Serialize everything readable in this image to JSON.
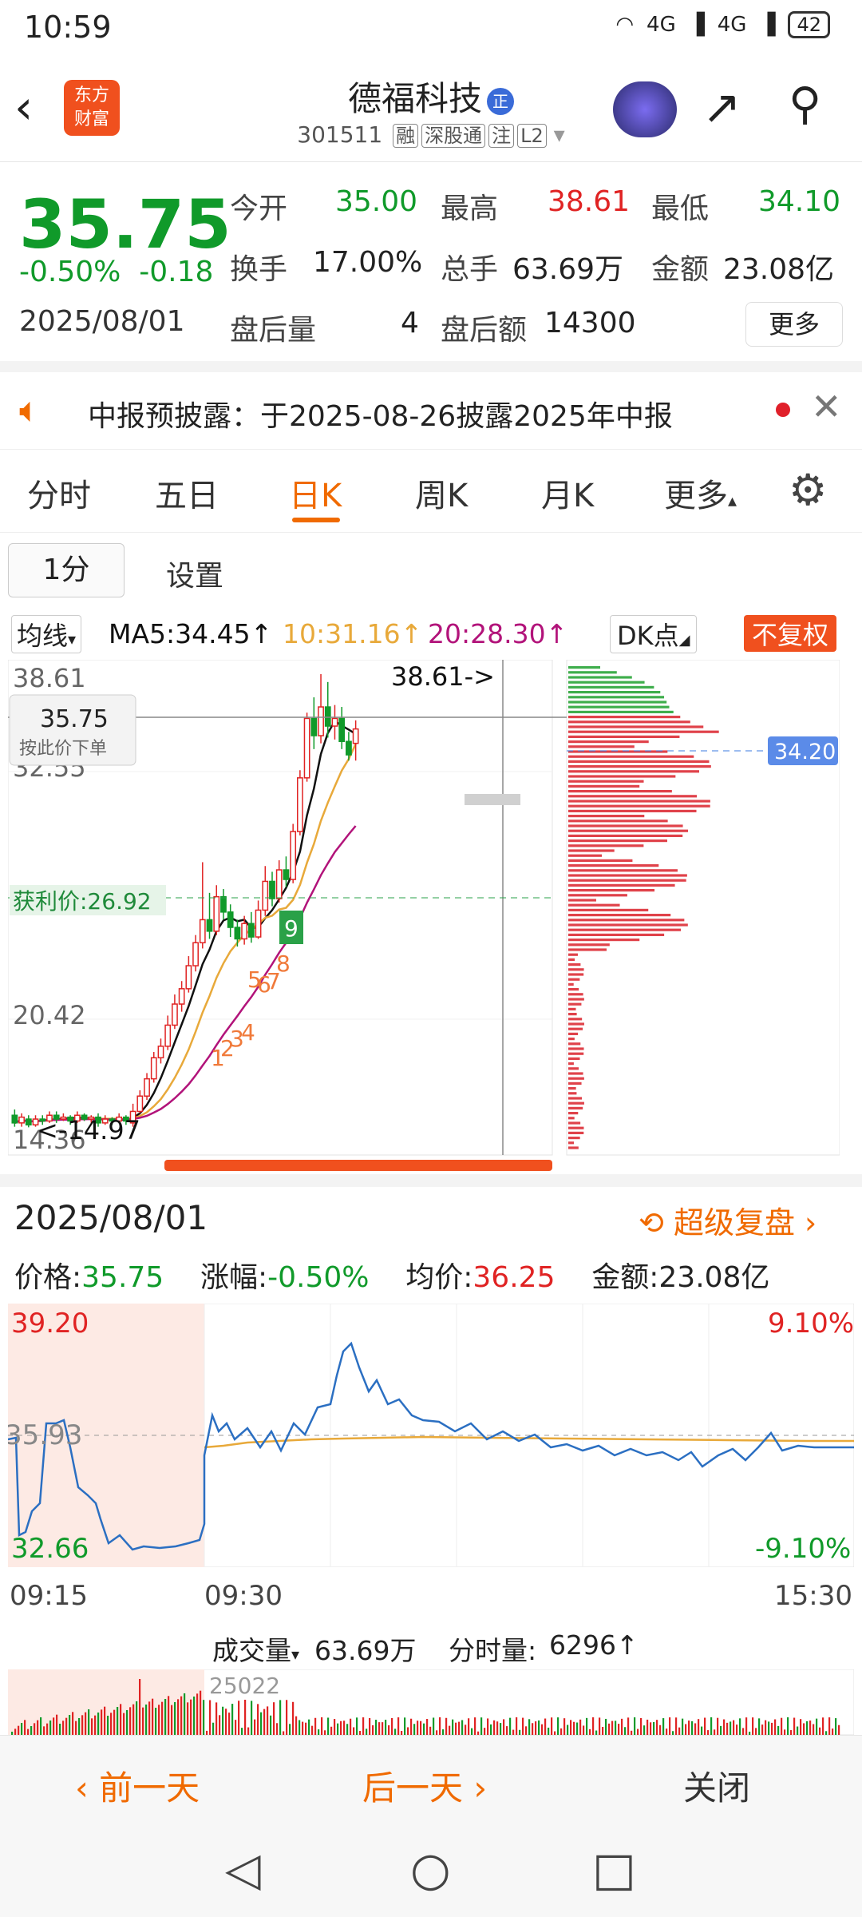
{
  "status": {
    "time": "10:59",
    "signal1": "4G",
    "signal2": "4G",
    "battery": "42"
  },
  "header": {
    "logo_line1": "东方",
    "logo_line2": "财富",
    "stock_name": "德福科技",
    "badge": "正",
    "stock_code": "301511",
    "tags": [
      "融",
      "深股通",
      "注",
      "L2"
    ]
  },
  "quote": {
    "price": "35.75",
    "change_pct": "-0.50%",
    "change": "-0.18",
    "date": "2025/08/01",
    "open_label": "今开",
    "open": "35.00",
    "high_label": "最高",
    "high": "38.61",
    "low_label": "最低",
    "low": "34.10",
    "turnover_label": "换手",
    "turnover": "17.00%",
    "volume_label": "总手",
    "volume": "63.69万",
    "amount_label": "金额",
    "amount": "23.08亿",
    "after_vol_label": "盘后量",
    "after_vol": "4",
    "after_amt_label": "盘后额",
    "after_amt": "14300",
    "more": "更多"
  },
  "notice": {
    "text": "中报预披露：于2025-08-26披露2025年中报"
  },
  "tabs": [
    "分时",
    "五日",
    "日K",
    "周K",
    "月K",
    "更多"
  ],
  "period": {
    "button": "1分",
    "settings": "设置"
  },
  "ma": {
    "selector": "均线",
    "ma5": "MA5:34.45↑",
    "ma10": "10:31.16↑",
    "ma20": "20:28.30↑",
    "dk": "DK点",
    "fq": "不复权"
  },
  "kchart": {
    "y_top": "38.61",
    "y_mid": "32.55",
    "y_low": "20.42",
    "y_bottom": "14.36",
    "high_marker": "38.61->",
    "low_marker": "<-14.97",
    "crosshair_price": "35.75",
    "crosshair_hint": "按此价下单",
    "cost_label": "获利价:26.92",
    "profile_price": "34.20",
    "signals": [
      "1",
      "2",
      "3",
      "4",
      "5",
      "6",
      "7",
      "8",
      "9"
    ]
  },
  "chart_data": {
    "type": "candlestick",
    "ylim": [
      14.36,
      38.61
    ],
    "candles": [
      {
        "o": 15.6,
        "c": 15.2,
        "h": 15.9,
        "l": 15.0
      },
      {
        "o": 15.2,
        "c": 15.5,
        "h": 15.7,
        "l": 15.0
      },
      {
        "o": 15.4,
        "c": 15.1,
        "h": 15.6,
        "l": 14.97
      },
      {
        "o": 15.1,
        "c": 15.4,
        "h": 15.6,
        "l": 15.0
      },
      {
        "o": 15.4,
        "c": 15.3,
        "h": 15.6,
        "l": 15.1
      },
      {
        "o": 15.3,
        "c": 15.6,
        "h": 15.8,
        "l": 15.2
      },
      {
        "o": 15.6,
        "c": 15.4,
        "h": 15.8,
        "l": 15.2
      },
      {
        "o": 15.4,
        "c": 15.5,
        "h": 15.7,
        "l": 15.3
      },
      {
        "o": 15.5,
        "c": 15.3,
        "h": 15.6,
        "l": 15.1
      },
      {
        "o": 15.3,
        "c": 15.6,
        "h": 15.8,
        "l": 15.2
      },
      {
        "o": 15.6,
        "c": 15.4,
        "h": 15.7,
        "l": 15.3
      },
      {
        "o": 15.4,
        "c": 15.5,
        "h": 15.6,
        "l": 15.2
      },
      {
        "o": 15.5,
        "c": 15.2,
        "h": 15.7,
        "l": 15.0
      },
      {
        "o": 15.2,
        "c": 15.4,
        "h": 15.6,
        "l": 15.1
      },
      {
        "o": 15.4,
        "c": 15.3,
        "h": 15.5,
        "l": 15.1
      },
      {
        "o": 15.3,
        "c": 15.5,
        "h": 15.7,
        "l": 15.2
      },
      {
        "o": 15.5,
        "c": 15.3,
        "h": 15.6,
        "l": 15.1
      },
      {
        "o": 15.2,
        "c": 15.8,
        "h": 16.2,
        "l": 15.0
      },
      {
        "o": 15.8,
        "c": 16.6,
        "h": 16.9,
        "l": 15.7
      },
      {
        "o": 16.6,
        "c": 17.5,
        "h": 17.8,
        "l": 16.4
      },
      {
        "o": 17.5,
        "c": 18.6,
        "h": 18.9,
        "l": 17.3
      },
      {
        "o": 18.6,
        "c": 19.2,
        "h": 19.6,
        "l": 18.3
      },
      {
        "o": 19.2,
        "c": 20.3,
        "h": 20.8,
        "l": 19.0
      },
      {
        "o": 20.3,
        "c": 21.4,
        "h": 21.9,
        "l": 20.1
      },
      {
        "o": 21.4,
        "c": 22.2,
        "h": 22.6,
        "l": 21.0
      },
      {
        "o": 22.2,
        "c": 23.4,
        "h": 23.9,
        "l": 22.0
      },
      {
        "o": 23.4,
        "c": 24.6,
        "h": 25.0,
        "l": 23.1
      },
      {
        "o": 24.6,
        "c": 25.8,
        "h": 28.8,
        "l": 24.3
      },
      {
        "o": 25.8,
        "c": 25.2,
        "h": 27.2,
        "l": 24.8
      },
      {
        "o": 25.2,
        "c": 27.0,
        "h": 27.6,
        "l": 25.0
      },
      {
        "o": 27.0,
        "c": 26.2,
        "h": 27.4,
        "l": 25.8
      },
      {
        "o": 26.2,
        "c": 25.4,
        "h": 26.6,
        "l": 24.9
      },
      {
        "o": 25.4,
        "c": 24.8,
        "h": 25.8,
        "l": 24.4
      },
      {
        "o": 24.8,
        "c": 25.6,
        "h": 26.0,
        "l": 24.5
      },
      {
        "o": 25.6,
        "c": 24.9,
        "h": 26.2,
        "l": 24.6
      },
      {
        "o": 24.9,
        "c": 26.3,
        "h": 26.8,
        "l": 24.8
      },
      {
        "o": 26.3,
        "c": 27.8,
        "h": 28.6,
        "l": 26.0
      },
      {
        "o": 27.8,
        "c": 26.9,
        "h": 28.3,
        "l": 26.5
      },
      {
        "o": 26.9,
        "c": 28.4,
        "h": 28.9,
        "l": 26.7
      },
      {
        "o": 28.4,
        "c": 27.9,
        "h": 29.1,
        "l": 27.5
      },
      {
        "o": 27.9,
        "c": 30.4,
        "h": 30.8,
        "l": 27.7
      },
      {
        "o": 30.4,
        "c": 33.2,
        "h": 33.6,
        "l": 30.2
      },
      {
        "o": 33.2,
        "c": 36.3,
        "h": 36.6,
        "l": 33.0
      },
      {
        "o": 36.3,
        "c": 35.4,
        "h": 37.4,
        "l": 34.7
      },
      {
        "o": 35.4,
        "c": 36.9,
        "h": 38.61,
        "l": 35.0
      },
      {
        "o": 36.9,
        "c": 35.9,
        "h": 38.2,
        "l": 35.3
      },
      {
        "o": 35.9,
        "c": 36.3,
        "h": 37.0,
        "l": 35.2
      },
      {
        "o": 36.3,
        "c": 35.1,
        "h": 36.9,
        "l": 34.7
      },
      {
        "o": 35.1,
        "c": 34.4,
        "h": 35.6,
        "l": 34.1
      },
      {
        "o": 35.0,
        "c": 35.75,
        "h": 36.2,
        "l": 34.1
      }
    ]
  },
  "replay": {
    "date": "2025/08/01",
    "super": "超级复盘",
    "price_label": "价格:",
    "price": "35.75",
    "pct_label": "涨幅:",
    "pct": "-0.50%",
    "avg_label": "均价:",
    "avg": "36.25",
    "amt_label": "金额:",
    "amt": "23.08亿"
  },
  "intraday": {
    "y_top": "39.20",
    "y_mid": "35.93",
    "y_bottom": "32.66",
    "pct_top": "9.10%",
    "pct_bottom": "-9.10%",
    "t_start": "09:15",
    "t_open": "09:30",
    "t_end": "15:30",
    "vol_selector": "成交量",
    "vol_total": "63.69万",
    "vol_tick_label": "分时量:",
    "vol_tick": "6296↑",
    "vol_max": "25022"
  },
  "bottom": {
    "prev": "前一天",
    "next": "后一天",
    "close": "关闭"
  },
  "colors": {
    "up": "#e02323",
    "down": "#109a2a",
    "accent": "#f06a00",
    "ma5": "#111111",
    "ma10": "#e8a93a",
    "ma20": "#b2137a"
  }
}
